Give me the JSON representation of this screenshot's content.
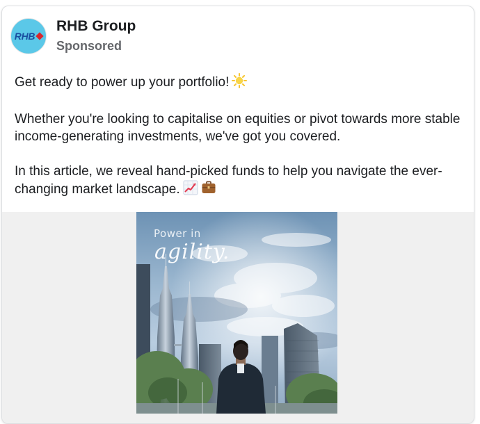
{
  "post": {
    "page_name": "RHB Group",
    "sponsored_label": "Sponsored",
    "avatar": {
      "logo_text": "RHB",
      "bg_color": "#5bc8e8",
      "text_color": "#1a4fa0",
      "accent_color": "#d9262c"
    },
    "paragraphs": [
      {
        "text": "Get ready to power up your portfolio!",
        "emoji": "sun-icon"
      },
      {
        "text": "Whether you're looking to capitalise on equities or pivot towards more stable income-generating investments, we've got you covered.",
        "emoji": null
      },
      {
        "text": "In this article, we reveal hand-picked funds to help you navigate the ever-changing market landscape.",
        "emoji": "chart-increasing-icon briefcase-icon"
      }
    ],
    "media": {
      "overlay_line_1": "Power in",
      "overlay_line_2": "agility."
    }
  }
}
